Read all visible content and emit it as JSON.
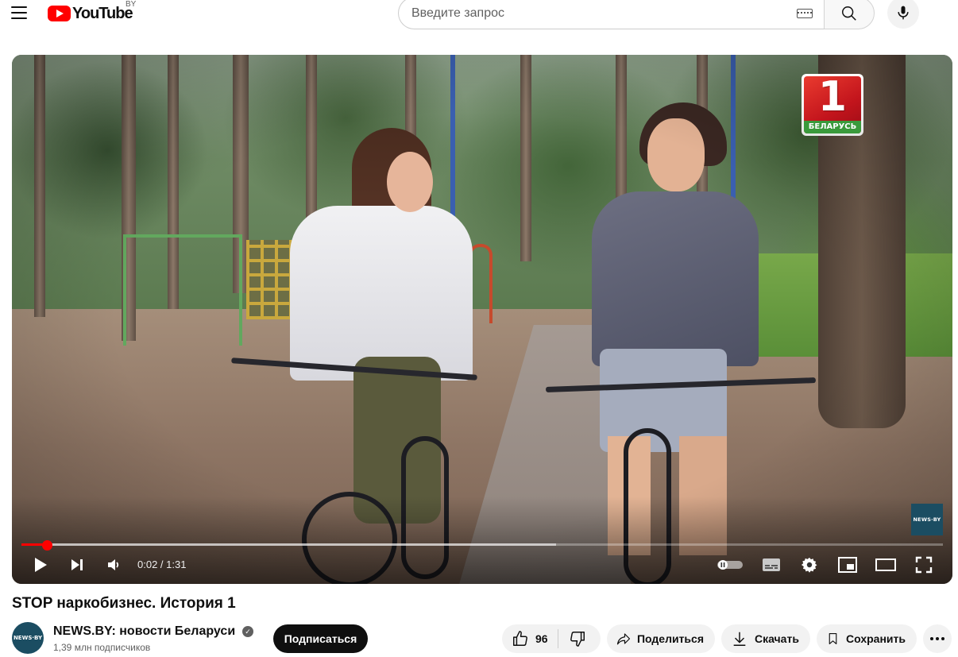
{
  "masthead": {
    "logo_text": "YouTube",
    "country_code": "BY",
    "search_placeholder": "Введите запрос",
    "icons": [
      "menu-icon",
      "youtube-logo",
      "keyboard-icon",
      "search-icon",
      "mic-icon"
    ]
  },
  "player": {
    "channel_logo": {
      "number": "1",
      "label": "БЕЛАРУСЬ"
    },
    "watermark_text": "NEWS·BY",
    "time_current": "0:02",
    "time_separator": " / ",
    "time_total": "1:31",
    "progress_played_fraction": 0.028,
    "progress_buffered_fraction": 0.58,
    "icons": [
      "play-icon",
      "next-icon",
      "volume-icon",
      "autoplay-toggle-icon",
      "subtitles-icon",
      "settings-icon",
      "miniplayer-icon",
      "theater-icon",
      "fullscreen-icon"
    ]
  },
  "video": {
    "title": "STOP наркобизнес. История 1",
    "channel_name": "NEWS.BY: новости Беларуси ...",
    "channel_avatar_text": "NEWS·BY",
    "subscribers": "1,39 млн подписчиков",
    "subscribe_label": "Подписаться"
  },
  "actions": {
    "like_count": "96",
    "share_label": "Поделиться",
    "download_label": "Скачать",
    "save_label": "Сохранить"
  },
  "colors": {
    "brand_red": "#ff0000",
    "subscribe_bg": "#0f0f0f",
    "pill_bg": "#f2f2f2",
    "channel_red": "#c2141c",
    "channel_green": "#3a9a3c"
  }
}
